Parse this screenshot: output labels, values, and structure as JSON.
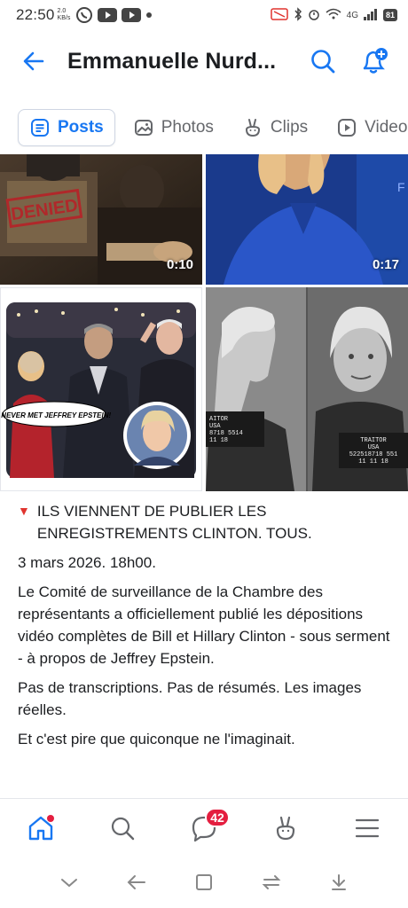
{
  "status_bar": {
    "time": "22:50",
    "speed_value": "2.0",
    "speed_unit": "KB/s",
    "battery": "81",
    "signal": "4G"
  },
  "header": {
    "title": "Emmanuelle Nurd..."
  },
  "tabs": [
    {
      "label": "Posts",
      "icon": "posts-icon",
      "active": true
    },
    {
      "label": "Photos",
      "icon": "photos-icon",
      "active": false
    },
    {
      "label": "Clips",
      "icon": "clips-icon",
      "active": false
    },
    {
      "label": "Videos",
      "icon": "videos-icon",
      "active": false
    }
  ],
  "media": {
    "video1_duration": "0:10",
    "video1_stamp": "DENIED",
    "video2_duration": "0:17",
    "photo1_caption": "I NEVER MET JEFFREY EPSTEIN!",
    "photo2_placard_left": "AITOR\nUSA\n8718 5514\n11 18",
    "photo2_placard_right": "TRAITOR\nUSA\n522518718 551\n11 11 18"
  },
  "post": {
    "headline": "ILS VIENNENT DE PUBLIER LES ENREGISTREMENTS CLINTON. TOUS.",
    "date": "3 mars 2026. 18h00.",
    "paragraph1": "Le Comité de surveillance de la Chambre des représentants a officiellement publié les dépositions vidéo complètes de Bill et Hillary Clinton - sous serment - à propos de Jeffrey Epstein.",
    "paragraph2": "Pas de transcriptions. Pas de résumés. Les images réelles.",
    "paragraph3": "Et c'est pire que quiconque ne l'imaginait."
  },
  "bottom_nav": {
    "messages_badge": "42"
  },
  "colors": {
    "accent": "#1877f2",
    "badge": "#e41e3f",
    "text": "#1c1e21",
    "muted": "#65676b"
  }
}
